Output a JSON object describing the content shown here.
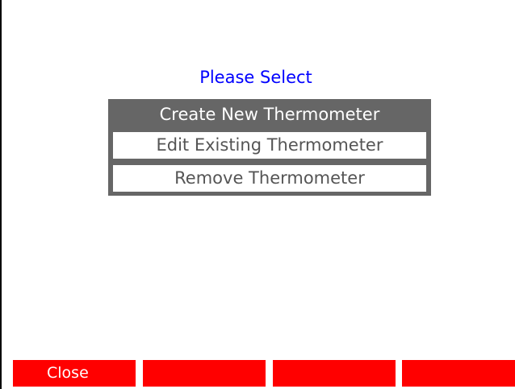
{
  "prompt": "Please Select",
  "menu": {
    "items": [
      {
        "label": "Create New Thermometer",
        "selected": true
      },
      {
        "label": "Edit Existing Thermometer",
        "selected": false
      },
      {
        "label": "Remove Thermometer",
        "selected": false
      }
    ]
  },
  "softkeys": [
    {
      "label": "Close"
    },
    {
      "label": ""
    },
    {
      "label": ""
    },
    {
      "label": ""
    }
  ],
  "colors": {
    "prompt": "#0000ff",
    "selected_bg": "#666666",
    "softkey_bg": "#ff0000"
  }
}
